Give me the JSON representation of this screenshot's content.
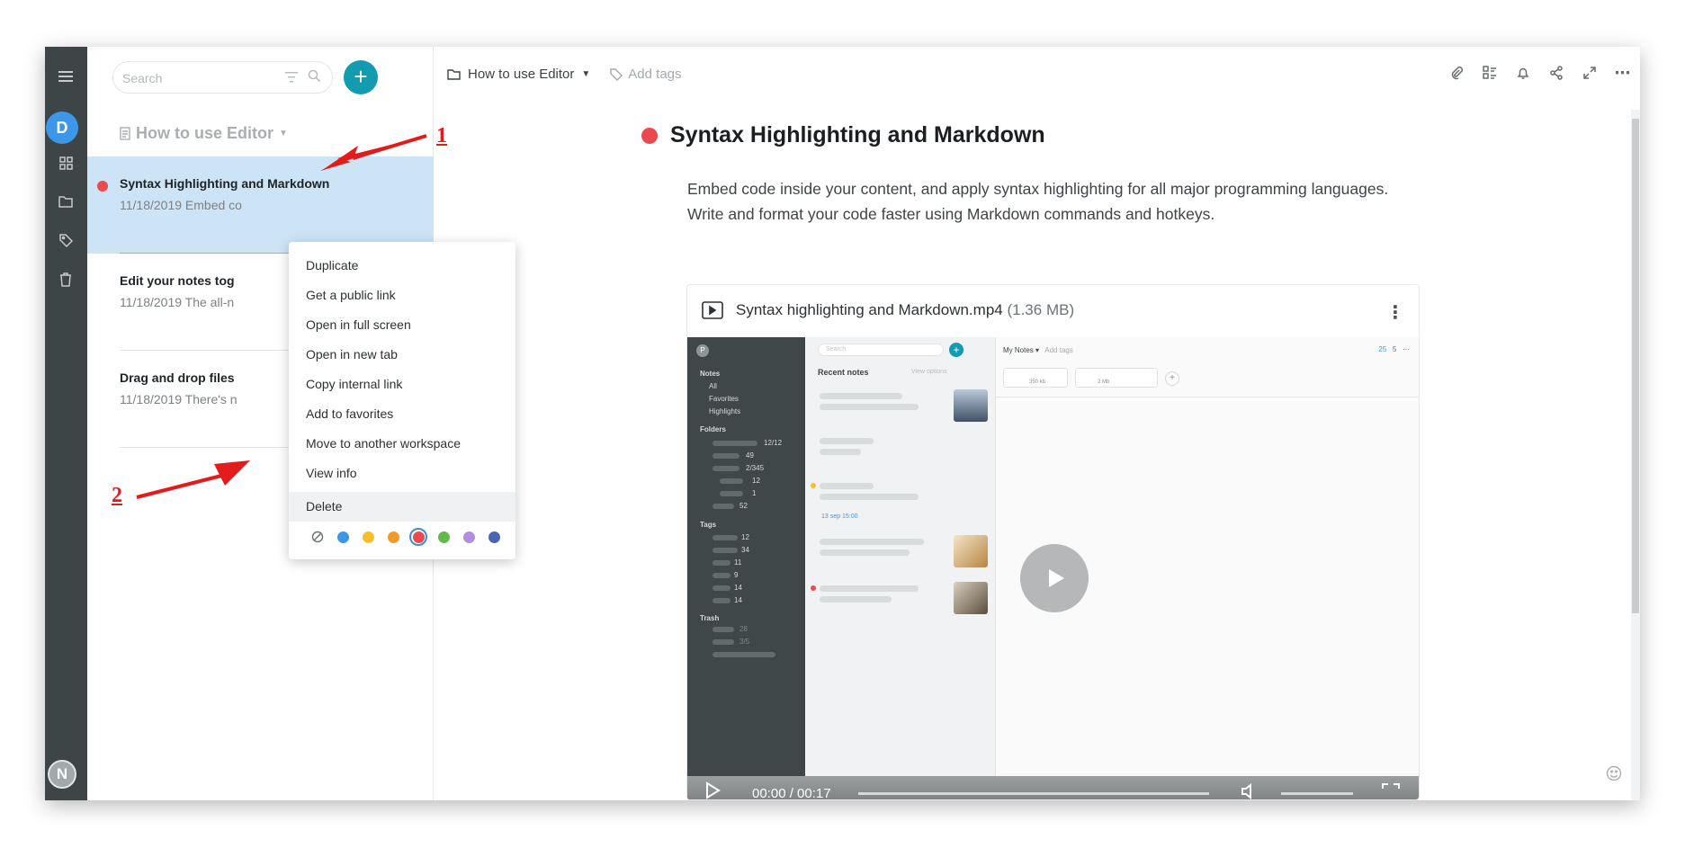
{
  "sidebar": {
    "user_initial": "D",
    "bottom_initial": "N"
  },
  "search": {
    "placeholder": "Search"
  },
  "folder": {
    "title": "How to use Editor"
  },
  "notes": [
    {
      "title": "Syntax Highlighting and Markdown",
      "date": "11/18/2019",
      "preview": "Embed co",
      "color": "#ea4a4f"
    },
    {
      "title": "Edit your notes tog",
      "date": "11/18/2019",
      "preview": "The all-n"
    },
    {
      "title": "Drag and drop files",
      "date": "11/18/2019",
      "preview": "There's n"
    }
  ],
  "context_menu": {
    "items": [
      "Duplicate",
      "Get a public link",
      "Open in full screen",
      "Open in new tab",
      "Copy internal link",
      "Add to favorites",
      "Move to another workspace",
      "View info",
      "Delete"
    ],
    "colors": [
      "#3d97e8",
      "#f5c02b",
      "#f39a2c",
      "#ea4a4f",
      "#66b84a",
      "#b18fdd",
      "#4a67b0"
    ],
    "selected_color": "#ea4a4f"
  },
  "editor": {
    "breadcrumb": "How to use Editor",
    "add_tags": "Add tags",
    "title": "Syntax Highlighting and Markdown",
    "body": "Embed code inside your content, and apply syntax highlighting for all major programming languages. Write and format your code faster using Markdown commands and hotkeys.",
    "attachment": {
      "name": "Syntax highlighting and Markdown.mp4",
      "size": "(1.36 MB)"
    },
    "video_time": "00:00 / 00:17"
  },
  "video_preview": {
    "search": "Search",
    "my_notes": "My Notes",
    "add_tags": "Add tags",
    "recent_notes": "Recent notes",
    "view_options": "View options",
    "sections": [
      "Notes",
      "All",
      "Favorites",
      "Highlights",
      "Folders",
      "Tags",
      "Trash"
    ],
    "counts": {
      "links": "25",
      "checklist": "5"
    },
    "files": [
      {
        "size": "350 kb"
      },
      {
        "size": "2 Mb"
      }
    ],
    "folder_counts": [
      "12/12",
      "49",
      "2/345",
      "12",
      "1",
      "52"
    ],
    "tag_counts": [
      "12",
      "34",
      "11",
      "9",
      "14",
      "14"
    ],
    "trash_counts": [
      "28",
      "3/5"
    ],
    "reminder": "13 sep 15:00"
  },
  "annotations": {
    "one": "1",
    "two": "2"
  }
}
